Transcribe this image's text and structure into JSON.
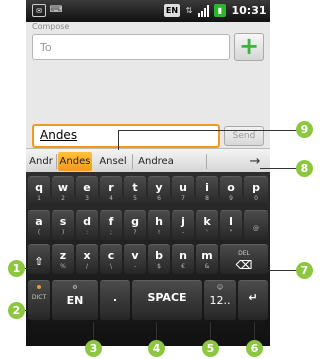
{
  "status_bar": {
    "notification_icon": "sms-notification-icon",
    "keyboard_icon": "keyboard-icon",
    "language_badge": "EN",
    "signal_icon": "signal-icon",
    "battery_icon": "battery-icon",
    "time": "10:31"
  },
  "compose": {
    "title": "Compose",
    "to_placeholder": "To",
    "add_label": "+",
    "message_text": "Andes",
    "send_label": "Send"
  },
  "suggestions": {
    "items": [
      "Andr",
      "Andes",
      "Ansel",
      "Andrea"
    ],
    "selected_index": 1,
    "more_arrow": "→"
  },
  "keyboard": {
    "row1": [
      {
        "main": "q",
        "sub": "1"
      },
      {
        "main": "w",
        "sub": "2"
      },
      {
        "main": "e",
        "sub": "3"
      },
      {
        "main": "r",
        "sub": "4"
      },
      {
        "main": "t",
        "sub": "5"
      },
      {
        "main": "y",
        "sub": "6"
      },
      {
        "main": "u",
        "sub": "7"
      },
      {
        "main": "i",
        "sub": "8"
      },
      {
        "main": "o",
        "sub": "9"
      },
      {
        "main": "p",
        "sub": "0"
      }
    ],
    "row2": [
      {
        "main": "a",
        "sub": "("
      },
      {
        "main": "s",
        "sub": ")"
      },
      {
        "main": "d",
        "sub": ":"
      },
      {
        "main": "f",
        "sub": ";"
      },
      {
        "main": "g",
        "sub": "?"
      },
      {
        "main": "h",
        "sub": "!"
      },
      {
        "main": "j",
        "sub": "-"
      },
      {
        "main": "k",
        "sub": "'"
      },
      {
        "main": "l",
        "sub": "\""
      },
      {
        "main": "",
        "sub": "@"
      }
    ],
    "row3": [
      {
        "main": "z",
        "sub": "%"
      },
      {
        "main": "x",
        "sub": "/"
      },
      {
        "main": "c",
        "sub": "\\"
      },
      {
        "main": "v",
        "sub": "-"
      },
      {
        "main": "b",
        "sub": "$"
      },
      {
        "main": "n",
        "sub": "€"
      },
      {
        "main": "m",
        "sub": "&"
      }
    ],
    "del_label": "DEL",
    "dict_label": "DICT",
    "lang_label": "EN",
    "period_label": ".",
    "space_label": "SPACE",
    "numbers_label": "12..",
    "shift_icon": "shift-arrow-icon",
    "enter_icon": "enter-icon",
    "del_icon": "backspace-icon"
  },
  "callouts": [
    "1",
    "2",
    "3",
    "4",
    "5",
    "6",
    "7",
    "8",
    "9"
  ],
  "colors": {
    "callout": "#8dc63f",
    "highlight": "#f29a1e",
    "add_button": "#3db33d"
  }
}
